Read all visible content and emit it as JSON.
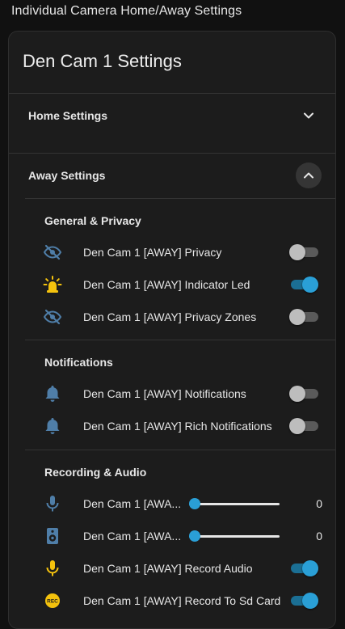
{
  "page": {
    "title": "Individual Camera Home/Away Settings"
  },
  "card": {
    "title": "Den Cam 1 Settings",
    "home": {
      "label": "Home Settings",
      "expanded": false
    },
    "away": {
      "label": "Away Settings",
      "expanded": true
    },
    "sections": [
      {
        "title": "General & Privacy",
        "rows": [
          {
            "label": "Den Cam 1 [AWAY] Privacy",
            "icon": "eye-off-icon",
            "state": "off"
          },
          {
            "label": "Den Cam 1 [AWAY] Indicator Led",
            "icon": "alarm-light-icon",
            "state": "on"
          },
          {
            "label": "Den Cam 1 [AWAY] Privacy Zones",
            "icon": "eye-off-icon",
            "state": "off"
          }
        ]
      },
      {
        "title": "Notifications",
        "rows": [
          {
            "label": "Den Cam 1 [AWAY] Notifications",
            "icon": "bell-icon",
            "state": "off"
          },
          {
            "label": "Den Cam 1 [AWAY] Rich Notifications",
            "icon": "bell-icon",
            "state": "off"
          }
        ]
      },
      {
        "title": "Recording & Audio",
        "rows": [
          {
            "label": "Den Cam 1 [AWA...",
            "icon": "microphone-icon",
            "value": "0",
            "level": 0
          },
          {
            "label": "Den Cam 1 [AWA...",
            "icon": "speaker-icon",
            "value": "0",
            "level": 0
          },
          {
            "label": "Den Cam 1 [AWAY] Record Audio",
            "icon": "microphone-icon",
            "state": "on"
          },
          {
            "label": "Den Cam 1 [AWAY] Record To Sd Card",
            "icon": "rec-icon",
            "state": "on"
          }
        ]
      }
    ]
  },
  "colors": {
    "accent": "#2a9fd6",
    "icon_off": "#4f7ea8",
    "icon_on": "#f4c20d"
  }
}
